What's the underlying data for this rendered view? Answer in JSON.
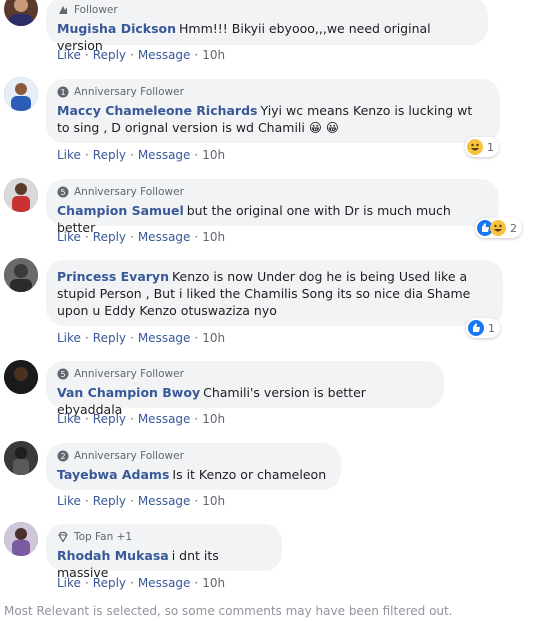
{
  "actions": {
    "like": "Like",
    "reply": "Reply",
    "message": "Message"
  },
  "comments": [
    {
      "badge": "Follower",
      "author": "Mugisha Dickson",
      "text": "Hmm!!! Bikyii ebyooo,,,we need original version",
      "time": "10h",
      "avatar_color": "#5a3a2a"
    },
    {
      "badge": "Anniversary Follower",
      "author": "Maccy Chameleone Richards",
      "text": "Yiyi wc means Kenzo is lucking wt to sing , D orignal version is wd Chamili 😀 😀",
      "time": "10h",
      "reaction_count": "1",
      "avatar_color": "#3a6fb0"
    },
    {
      "badge": "Anniversary Follower",
      "author": "Champion Samuel",
      "text": "but the original one with Dr is much much better",
      "time": "10h",
      "reaction_count": "2",
      "avatar_color": "#b04040"
    },
    {
      "author": "Princess Evaryn",
      "text": "Kenzo is now Under dog he is being Used like a stupid Person , But i liked the Chamilis Song its so nice dia Shame upon u Eddy Kenzo otuswaziza nyo",
      "time": "10h",
      "reaction_count": "1",
      "avatar_color": "#4a4a4a"
    },
    {
      "badge": "Anniversary Follower",
      "author": "Van Champion Bwoy",
      "text": "Chamili's version is better ebyaddala",
      "time": "10h",
      "avatar_color": "#222222"
    },
    {
      "badge": "Anniversary Follower",
      "author": "Tayebwa Adams",
      "text": "Is it Kenzo or chameleon",
      "time": "10h",
      "avatar_color": "#2b2b2b"
    },
    {
      "badge": "Top Fan +1",
      "author": "Rhodah Mukasa",
      "text": "i dnt its massive",
      "time": "10h",
      "avatar_color": "#8a7a9a"
    }
  ],
  "footer": "Most Relevant is selected, so some comments may have been filtered out."
}
